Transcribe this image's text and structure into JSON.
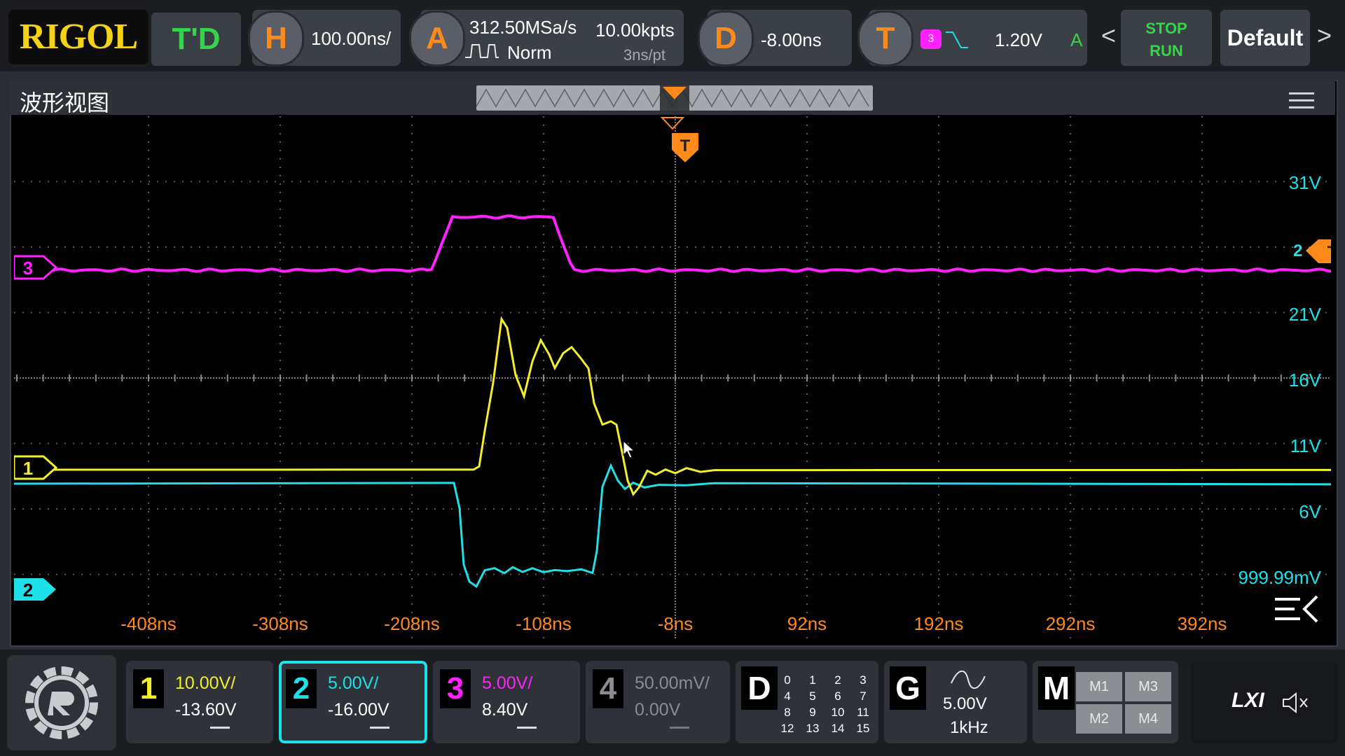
{
  "topbar": {
    "logo": "RIGOL",
    "mode": "T'D",
    "horizontal": {
      "icon": "H",
      "scale": "100.00ns/"
    },
    "acquire": {
      "icon": "A",
      "sample_rate": "312.50MSa/s",
      "memory_depth": "10.00kpts",
      "mode": "Norm",
      "time_per_point": "3ns/pt"
    },
    "delay": {
      "icon": "D",
      "value": "-8.00ns"
    },
    "trigger": {
      "icon": "T",
      "source_channel": "3",
      "level": "1.20V",
      "mode": "A"
    },
    "stop_label": "STOP",
    "run_label": "RUN",
    "default_label": "Default",
    "chevron_left": "<",
    "chevron_right": ">"
  },
  "window": {
    "title": "波形视图"
  },
  "plot": {
    "trigger_marker": "T",
    "right_trigger_marker": "T",
    "right_trigger_prefix": "2",
    "channel_markers": [
      {
        "label": "3",
        "color": "#ff22ff"
      },
      {
        "label": "1",
        "color": "#f3ef2a"
      },
      {
        "label": "2",
        "color": "#1fe0e8"
      }
    ],
    "time_labels": [
      "-408ns",
      "-308ns",
      "-208ns",
      "-108ns",
      "-8ns",
      "92ns",
      "192ns",
      "292ns",
      "392ns"
    ],
    "volt_labels": [
      "31V",
      "21V",
      "16V",
      "11V",
      "6V",
      "999.99mV"
    ],
    "colors": {
      "ch1": "#f3ef2a",
      "ch2": "#1fe0e8",
      "ch3": "#ff22ff",
      "time_label": "#ff8a1c",
      "grid": "#5c5c5c"
    }
  },
  "channels": [
    {
      "num": "1",
      "scale": "10.00V/",
      "offset": "-13.60V",
      "color": "#f3ef2a",
      "active": false
    },
    {
      "num": "2",
      "scale": "5.00V/",
      "offset": "-16.00V",
      "color": "#1fe0e8",
      "active": true
    },
    {
      "num": "3",
      "scale": "5.00V/",
      "offset": "8.40V",
      "color": "#ff22ff",
      "active": false
    },
    {
      "num": "4",
      "scale": "50.00mV/",
      "offset": "0.00V",
      "color": "#6e7076",
      "active": false
    }
  ],
  "digital": {
    "label": "D",
    "bits": [
      "0",
      "1",
      "2",
      "3",
      "4",
      "5",
      "6",
      "7",
      "8",
      "9",
      "10",
      "11",
      "12",
      "13",
      "14",
      "15"
    ]
  },
  "generator": {
    "label": "G",
    "amplitude": "5.00V",
    "frequency": "1kHz"
  },
  "math": {
    "label": "M",
    "buttons": [
      "M1",
      "M3",
      "M2",
      "M4"
    ]
  },
  "status": {
    "lxi": "LXI"
  }
}
